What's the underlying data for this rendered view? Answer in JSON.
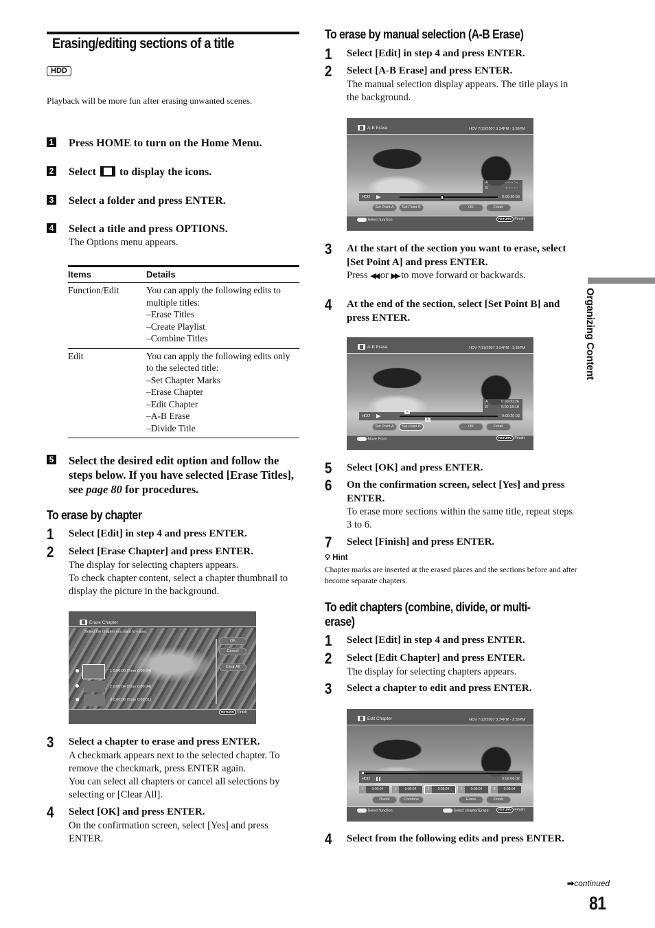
{
  "title": "Erasing/editing sections of a title",
  "badge": "HDD",
  "intro": "Playback will be more fun after erasing unwanted scenes.",
  "main_steps": [
    {
      "num": "1",
      "text": "Press HOME to turn on the Home Menu."
    },
    {
      "num": "2",
      "text_before": "Select",
      "icon": "film-icon",
      "text_after": "to display the icons."
    },
    {
      "num": "3",
      "text": "Select a folder and press ENTER."
    },
    {
      "num": "4",
      "text": "Select a title and press OPTIONS.",
      "note": "The Options menu appears."
    },
    {
      "num": "5",
      "text_a": "Select the desired edit option and follow the steps below. If you have selected [Erase Titles], see ",
      "link": "page 80",
      "text_b": " for procedures."
    }
  ],
  "options_table": {
    "headers": [
      "Items",
      "Details"
    ],
    "rows": [
      {
        "item": "Function/Edit",
        "details": [
          "You can apply the following edits to multiple titles:",
          "–Erase Titles",
          "–Create Playlist",
          "–Combine Titles"
        ]
      },
      {
        "item": "Edit",
        "details": [
          "You can apply the following edits only to the selected title:",
          "–Set Chapter Marks",
          "–Erase Chapter",
          "–Edit Chapter",
          "–A-B Erase",
          "–Divide Title"
        ]
      }
    ]
  },
  "erase_by_chapter": {
    "heading": "To erase by chapter",
    "steps": [
      {
        "num": "1",
        "text": "Select [Edit] in step 4 and press ENTER."
      },
      {
        "num": "2",
        "text": "Select [Erase Chapter] and press ENTER.",
        "notes": [
          "The display for selecting chapters appears.",
          "To check chapter content, select a chapter thumbnail to display the picture in the background."
        ]
      },
      {
        "num": "3",
        "text": "Select a chapter to erase and press ENTER.",
        "notes": [
          "A checkmark appears next to the selected chapter. To remove the checkmark, press ENTER again.",
          "You can select all chapters or cancel all selections by selecting or [Clear All]."
        ]
      },
      {
        "num": "4",
        "text": "Select [OK] and press ENTER.",
        "notes": [
          "On the confirmation screen, select [Yes] and press ENTER."
        ]
      }
    ],
    "screen": {
      "title": "Erase Chapter",
      "prompt": "Select the chapter you want to erase.",
      "buttons": [
        "OK",
        "Cancel",
        "Clear All"
      ],
      "chapters": [
        "1  0:00:00 (Time 0:00:04)",
        "2  0:00:04 (Time 0:00:04)",
        "3  0:00:08 (Time 0:00:01)"
      ],
      "return_key": "RETURN",
      "return_label": "Finish"
    }
  },
  "ab_erase": {
    "heading": "To erase by manual selection (A-B Erase)",
    "steps": [
      {
        "num": "1",
        "text": "Select [Edit] in step 4 and press ENTER."
      },
      {
        "num": "2",
        "text": "Select [A-B Erase] and press ENTER.",
        "notes": [
          "The manual selection display appears. The title plays in the background."
        ]
      },
      {
        "num": "3",
        "text": "At the start of the section you want to erase, select [Set Point A] and press ENTER.",
        "note_a": "Press ",
        "rew": "◀◀",
        "note_or": " or ",
        "ff": "▶▶",
        "note_b": " to move forward or backwards."
      },
      {
        "num": "4",
        "text": "At the end of the section, select [Set Point B] and press ENTER."
      },
      {
        "num": "5",
        "text": "Select [OK] and press ENTER."
      },
      {
        "num": "6",
        "text": "On the confirmation screen, select [Yes] and press ENTER.",
        "notes": [
          "To erase more sections within the same title, repeat steps 3 to 6."
        ]
      },
      {
        "num": "7",
        "text": "Select [Finish] and press ENTER."
      }
    ],
    "hint_label": "Hint",
    "hint_text": "Chapter marks are inserted at the erased places and the sections before and after become separate chapters.",
    "screen1": {
      "title": "A-B Erase",
      "info": "HDV  7/13/2007  3:34PM -  3:35PM",
      "a_label": "A",
      "a_value": "-:--:-- :--",
      "b_label": "B",
      "b_value": "-:--:-- :--",
      "media": "HDD",
      "time": "0:00:20:03",
      "progress": 0.42,
      "buttons": [
        "Set Point A",
        "Set Point B",
        "OK",
        "Finish"
      ],
      "hint": "Select function",
      "return_key": "RETURN",
      "return_label": "Finish"
    },
    "screen2": {
      "title": "A-B Erase",
      "info": "HDV  7/13/2007  3:34PM -  3:35PM",
      "a_label": "A",
      "a_value": "0:00:00:26",
      "b_label": "B",
      "b_value": "0:00:18:18",
      "media": "HDD",
      "time": "0:00:20:03",
      "buttons": [
        "Set Point A",
        "Set Point B",
        "OK",
        "Finish"
      ],
      "hint": "Move Point",
      "return_key": "RETURN",
      "return_label": "Finish"
    }
  },
  "edit_chapters": {
    "heading": "To edit chapters (combine, divide, or multi-erase)",
    "steps": [
      {
        "num": "1",
        "text": "Select [Edit] in step 4 and press ENTER."
      },
      {
        "num": "2",
        "text": "Select [Edit Chapter] and press ENTER.",
        "notes": [
          "The display for selecting chapters appears."
        ]
      },
      {
        "num": "3",
        "text": "Select a chapter to edit and press ENTER."
      },
      {
        "num": "4",
        "text": "Select from the following edits and press ENTER."
      }
    ],
    "screen": {
      "title": "Edit Chapter",
      "info": "HDV  7/13/2007  3:34PM -  3:35PM",
      "media": "HDD",
      "time": "0:00:06:02",
      "chapters": [
        {
          "n": "1",
          "t": "0:00:04"
        },
        {
          "n": "2",
          "t": "0:00:04"
        },
        {
          "n": "3",
          "t": "0:00:04"
        },
        {
          "n": "4",
          "t": "0:00:04"
        },
        {
          "n": "5",
          "t": "0:00:04"
        }
      ],
      "buttons": [
        "Divide",
        "Combine",
        "Erase",
        "Finish"
      ],
      "hint1": "Select function",
      "hint2": "Select chapter/Erase",
      "return_key": "RETURN",
      "return_label": "Finish"
    }
  },
  "side_tab": "Organizing Content",
  "continued": "continued",
  "page_number": "81"
}
